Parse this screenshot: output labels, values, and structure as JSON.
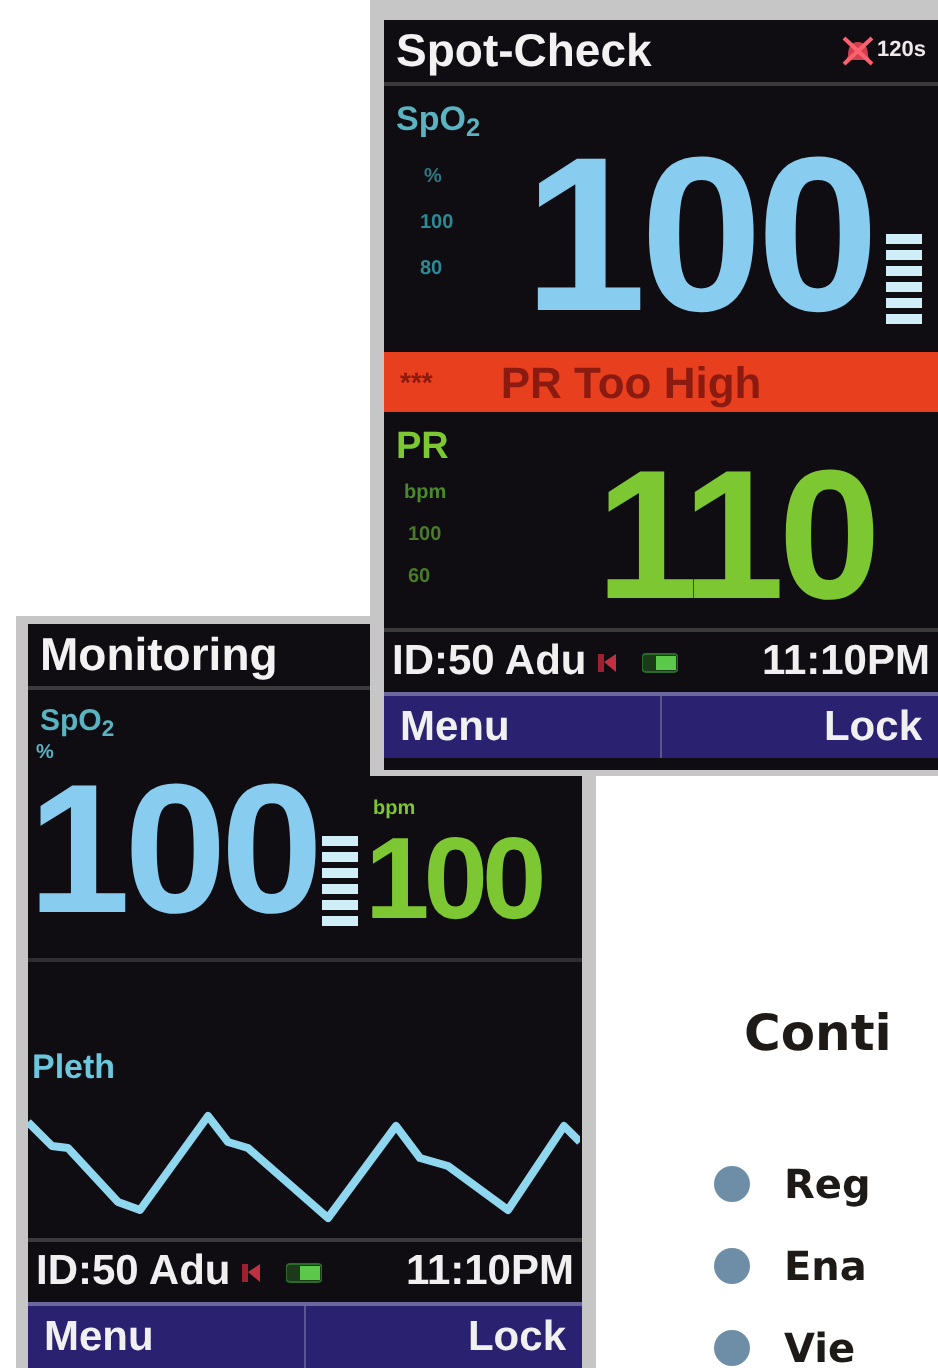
{
  "screens": [
    {
      "kind": "monitoring",
      "title": "Monitoring",
      "spo2": {
        "label": "SpO$_{2}$",
        "unit": "%",
        "value": "100"
      },
      "pr": {
        "unit": "bpm",
        "value": "100"
      },
      "pleth": {
        "label": "Pleth"
      },
      "status": {
        "id": "ID:50 Adu",
        "time": "11:10PM"
      },
      "softkeys": [
        "Menu",
        "Lock"
      ]
    },
    {
      "kind": "spot-check",
      "title": "Spot-Check",
      "timer": "120s",
      "spo2": {
        "label": "SpO$_{2}$",
        "unit": "%",
        "scale": [
          "100",
          "80"
        ],
        "value": "100"
      },
      "alarm": {
        "marks": "***",
        "text": "PR Too High"
      },
      "pr": {
        "label": "PR",
        "unit": "bpm",
        "scale": [
          "100",
          "60"
        ],
        "value": "110"
      },
      "status": {
        "id": "ID:50 Adu",
        "time": "11:10PM"
      },
      "softkeys": [
        "Menu",
        "Lock"
      ]
    }
  ],
  "brochure": {
    "heading": "Conti",
    "bullets": [
      "Reg",
      "Ena",
      "Vie"
    ]
  }
}
